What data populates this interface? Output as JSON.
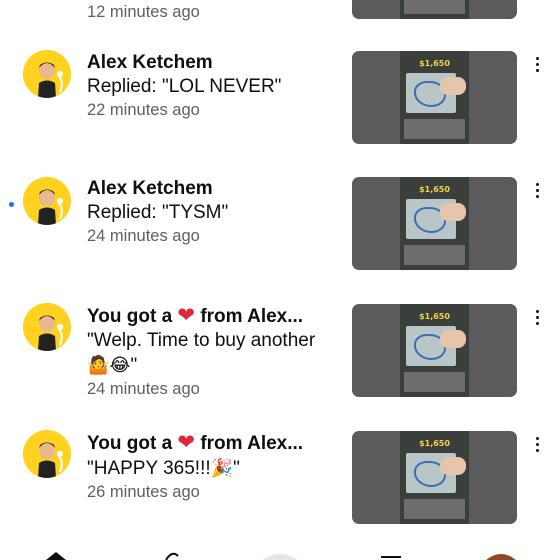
{
  "previous_item": {
    "time": "12 minutes ago"
  },
  "items": [
    {
      "title": "Alex Ketchem",
      "body": "Replied: \"LOL NEVER\"",
      "time": "22 minutes ago",
      "unread": false,
      "thumbnail_price": "$1,650"
    },
    {
      "title": "Alex Ketchem",
      "body": "Replied: \"TYSM\"",
      "time": "24 minutes ago",
      "unread": true,
      "thumbnail_price": "$1,650"
    },
    {
      "title_prefix": "You got a",
      "title_suffix": "from Alex...",
      "body": "\"Welp. Time to buy another",
      "body_line2_emoji": "🤷😂",
      "body_line2_tail": "\"",
      "time": "24 minutes ago",
      "unread": false,
      "thumbnail_price": "$1,650"
    },
    {
      "title_prefix": "You got a",
      "title_suffix": "from Alex...",
      "body": "\"HAPPY 365!!!",
      "body_emoji": "🎉",
      "body_tail": "\"",
      "time": "26 minutes ago",
      "unread": false,
      "thumbnail_price": "$1,650"
    }
  ],
  "colors": {
    "unread_dot": "#1a73e8",
    "heart": "#e0243a",
    "avatar_bg": "#ffd21f",
    "secondary_text": "#606060"
  },
  "icons": {
    "heart": "❤",
    "more": "more-vert-icon"
  }
}
